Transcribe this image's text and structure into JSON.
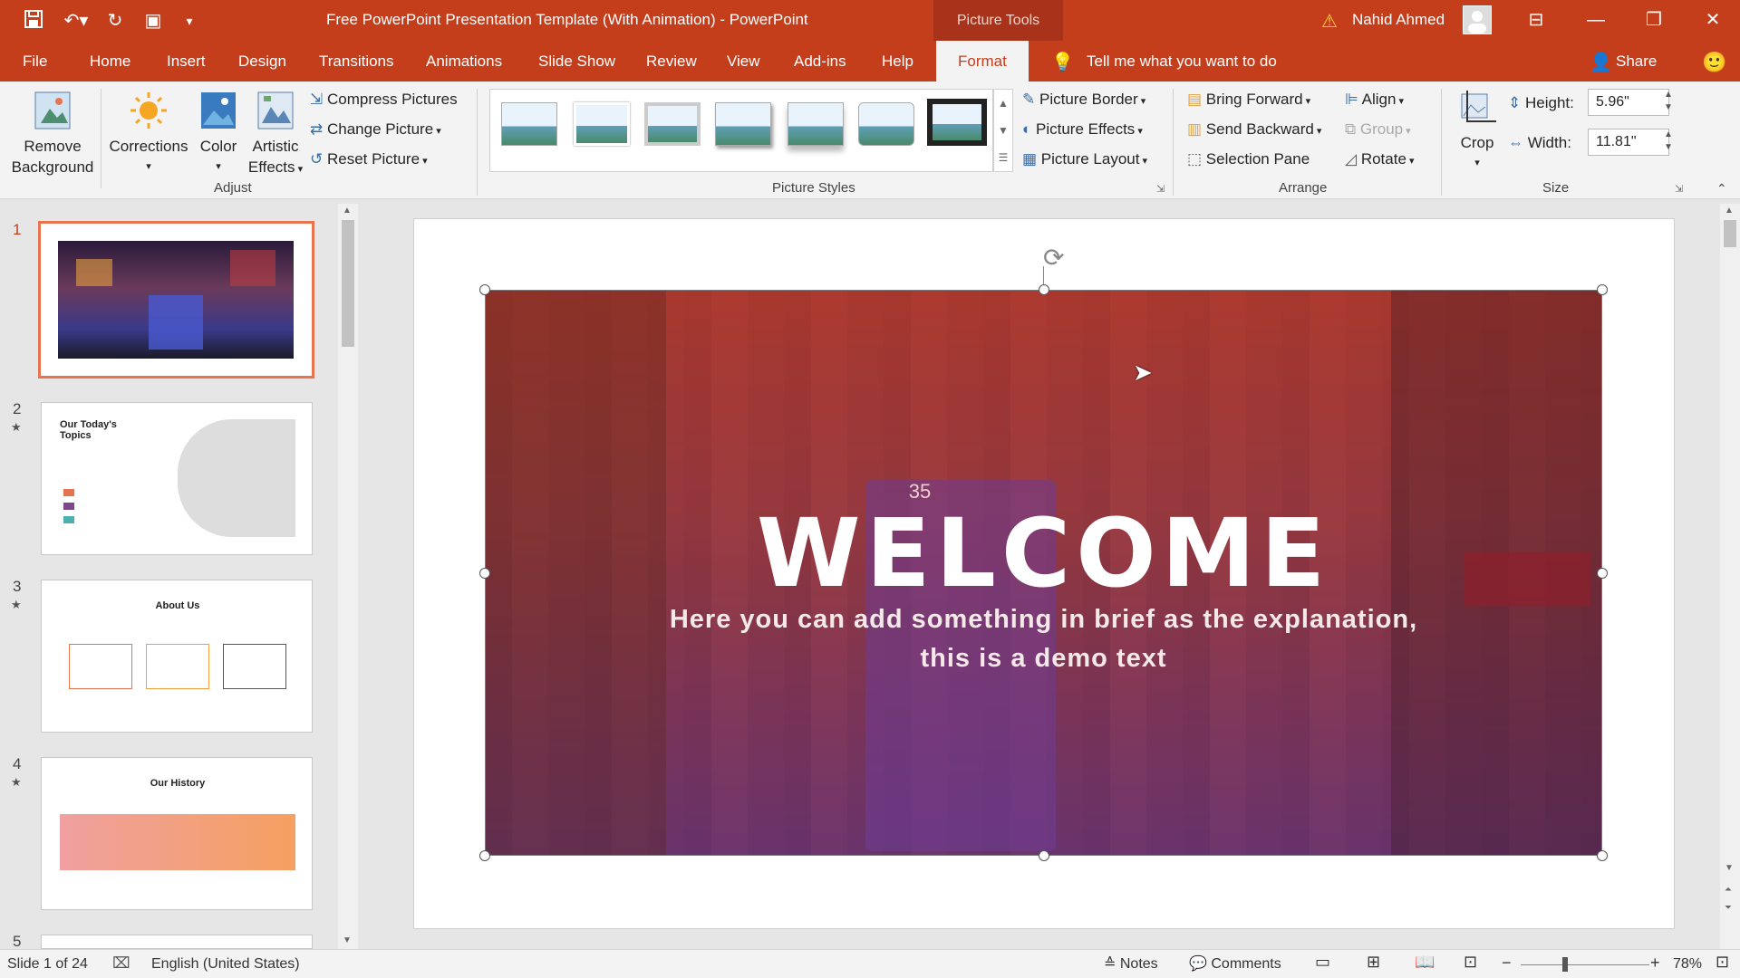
{
  "window": {
    "title": "Free PowerPoint Presentation Template (With Animation)  -  PowerPoint",
    "contextual_tab_group": "Picture Tools",
    "user_name": "Nahid Ahmed",
    "warning_icon": "warning-icon"
  },
  "tabs": [
    "File",
    "Home",
    "Insert",
    "Design",
    "Transitions",
    "Animations",
    "Slide Show",
    "Review",
    "View",
    "Add-ins",
    "Help",
    "Format"
  ],
  "active_tab": "Format",
  "tell_me": "Tell me what you want to do",
  "share_label": "Share",
  "ribbon": {
    "adjust": {
      "group_label": "Adjust",
      "remove_background": [
        "Remove",
        "Background"
      ],
      "corrections": "Corrections",
      "color": "Color",
      "artistic_effects": [
        "Artistic",
        "Effects"
      ],
      "compress_pictures": "Compress Pictures",
      "change_picture": "Change Picture",
      "reset_picture": "Reset Picture"
    },
    "picture_styles": {
      "group_label": "Picture Styles",
      "picture_border": "Picture Border",
      "picture_effects": "Picture Effects",
      "picture_layout": "Picture Layout"
    },
    "arrange": {
      "group_label": "Arrange",
      "bring_forward": "Bring Forward",
      "send_backward": "Send Backward",
      "selection_pane": "Selection Pane",
      "align": "Align",
      "group": "Group",
      "rotate": "Rotate"
    },
    "size": {
      "group_label": "Size",
      "crop": "Crop",
      "height_label": "Height:",
      "height_value": "5.96\"",
      "width_label": "Width:",
      "width_value": "11.81\""
    }
  },
  "slides": [
    {
      "num": "1",
      "starred": false,
      "title": ""
    },
    {
      "num": "2",
      "starred": true,
      "title": "Our Today's Topics"
    },
    {
      "num": "3",
      "starred": true,
      "title": "About Us"
    },
    {
      "num": "4",
      "starred": true,
      "title": "Our History"
    },
    {
      "num": "5",
      "starred": false,
      "title": ""
    }
  ],
  "slide": {
    "heading": "WELCOME",
    "subtext_line1": "Here you can add something in brief as the explanation,",
    "subtext_line2": "this is a demo text",
    "tram_number": "35"
  },
  "status": {
    "slide_counter": "Slide 1 of 24",
    "language": "English (United States)",
    "notes": "Notes",
    "comments": "Comments",
    "zoom": "78%"
  },
  "colors": {
    "accent": "#c43e1c",
    "ribbon_bg": "#f3f3f3",
    "selected_thumb_border": "#e8734f"
  }
}
